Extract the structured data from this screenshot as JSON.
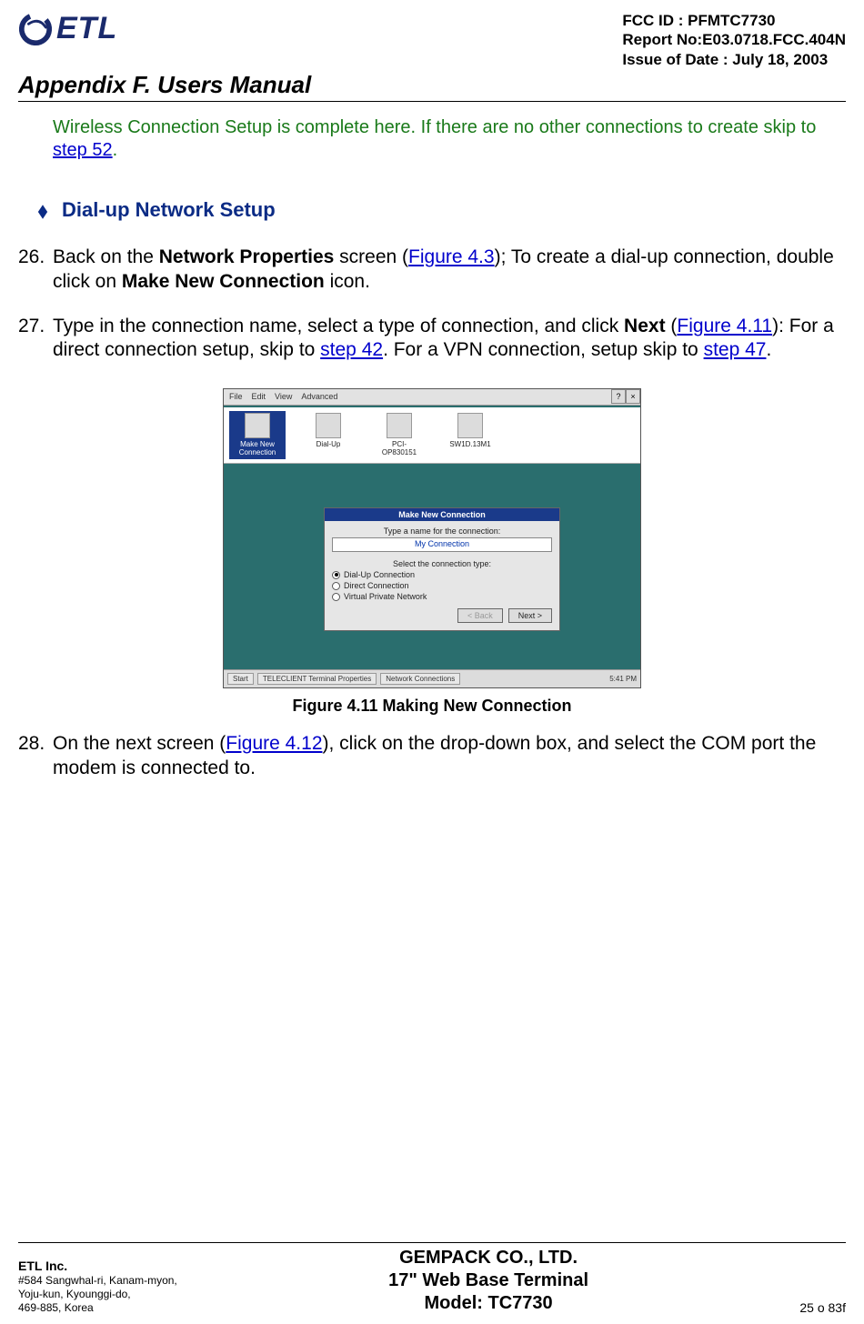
{
  "header": {
    "logo_text": "ETL",
    "fcc_id": "FCC ID : PFMTC7730",
    "report_no": "Report No:E03.0718.FCC.404N",
    "issue_date": "Issue of Date : July 18, 2003",
    "appendix_title": "Appendix F.  Users Manual"
  },
  "intro": {
    "text": "Wireless Connection Setup is complete here.  If there are no other connections to create skip to ",
    "link": "step 52",
    "after": "."
  },
  "section": {
    "title": "Dial-up Network Setup"
  },
  "steps": {
    "s26": {
      "num": "26.",
      "t1": "Back on the ",
      "b1": "Network Properties",
      "t2": " screen (",
      "l1": "Figure 4.3",
      "t3": "); To create a dial-up connection, double click on ",
      "b2": "Make New Connection",
      "t4": " icon."
    },
    "s27": {
      "num": "27.",
      "t1": "Type in the connection name, select a type of connection, and click ",
      "b1": "Next",
      "t2": " (",
      "l1": "Figure 4.11",
      "t3": "):  For a direct connection setup, skip to ",
      "l2": "step 42",
      "t4": ".  For a VPN connection, setup skip to ",
      "l3": "step 47",
      "t5": "."
    },
    "s28": {
      "num": "28.",
      "t1": "On the next screen (",
      "l1": "Figure 4.12",
      "t2": "), click on the drop-down box, and select the COM port the modem is connected to."
    }
  },
  "mock": {
    "menu": {
      "file": "File",
      "edit": "Edit",
      "view": "View",
      "advanced": "Advanced"
    },
    "topbtn": {
      "help": "?",
      "close": "×"
    },
    "icons": {
      "i1": "Make New Connection",
      "i2": "Dial-Up",
      "i3": "PCI-\nOP830151",
      "i4": "SW1D.13M1"
    },
    "dialog": {
      "title": "Make New Connection",
      "prompt": "Type a name for the connection:",
      "input": "My Connection",
      "select_label": "Select the connection type:",
      "r1": "Dial-Up Connection",
      "r2": "Direct Connection",
      "r3": "Virtual Private Network",
      "back": "< Back",
      "next": "Next >"
    },
    "taskbar": {
      "start": "Start",
      "app1": "TELECLIENT Terminal Properties",
      "app2": "Network Connections",
      "clock": "5:41 PM"
    }
  },
  "figure": {
    "caption": "Figure 4.11       Making New Connection"
  },
  "footer": {
    "company": "ETL Inc.",
    "addr1": "#584 Sangwhal-ri, Kanam-myon,",
    "addr2": "Yoju-kun, Kyounggi-do,",
    "addr3": "469-885, Korea",
    "center1": "GEMPACK CO., LTD.",
    "center2": "17\" Web Base Terminal",
    "center3": "Model: TC7730",
    "page": "25 o 83f"
  }
}
